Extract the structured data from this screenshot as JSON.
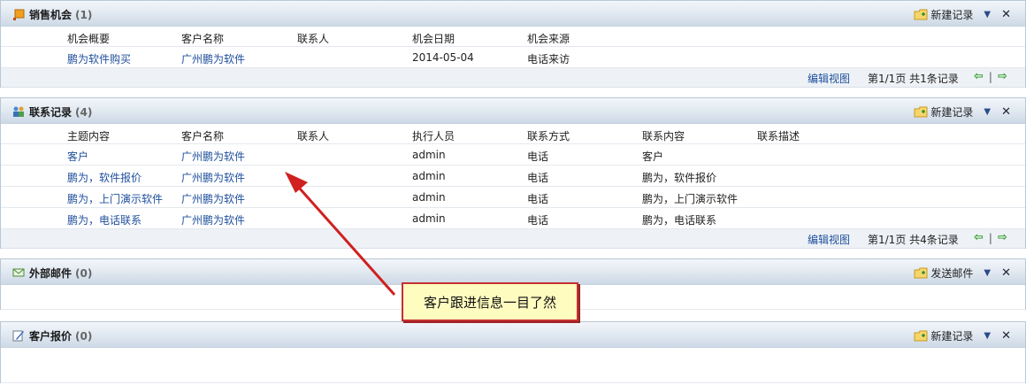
{
  "panels": {
    "sales": {
      "title": "销售机会",
      "count": "(1)",
      "action": "新建记录",
      "columns": [
        "机会概要",
        "客户名称",
        "联系人",
        "机会日期",
        "机会来源"
      ],
      "rows": [
        [
          "鹏为软件购买",
          "广州鹏为软件",
          "",
          "2014-05-04",
          "电话来访"
        ]
      ],
      "footer": {
        "edit_view": "编辑视图",
        "page_info": "第1/1页 共1条记录"
      }
    },
    "contact": {
      "title": "联系记录",
      "count": "(4)",
      "action": "新建记录",
      "columns": [
        "主题内容",
        "客户名称",
        "联系人",
        "执行人员",
        "联系方式",
        "联系内容",
        "联系描述"
      ],
      "rows": [
        [
          "客户",
          "广州鹏为软件",
          "",
          "admin",
          "电话",
          "客户",
          ""
        ],
        [
          "鹏为，软件报价",
          "广州鹏为软件",
          "",
          "admin",
          "电话",
          "鹏为，软件报价",
          ""
        ],
        [
          "鹏为，上门演示软件",
          "广州鹏为软件",
          "",
          "admin",
          "电话",
          "鹏为，上门演示软件",
          ""
        ],
        [
          "鹏为，电话联系",
          "广州鹏为软件",
          "",
          "admin",
          "电话",
          "鹏为，电话联系",
          ""
        ]
      ],
      "footer": {
        "edit_view": "编辑视图",
        "page_info": "第1/1页 共4条记录"
      }
    },
    "email": {
      "title": "外部邮件",
      "count": "(0)",
      "action": "发送邮件"
    },
    "quote": {
      "title": "客户报价",
      "count": "(0)",
      "action": "新建记录"
    }
  },
  "callout": "客户跟进信息一目了然",
  "colors": {
    "link": "#1f4f9c",
    "callout_border": "#c43030",
    "callout_bg": "#fffcc0",
    "arrow_green": "#2c9a24"
  }
}
